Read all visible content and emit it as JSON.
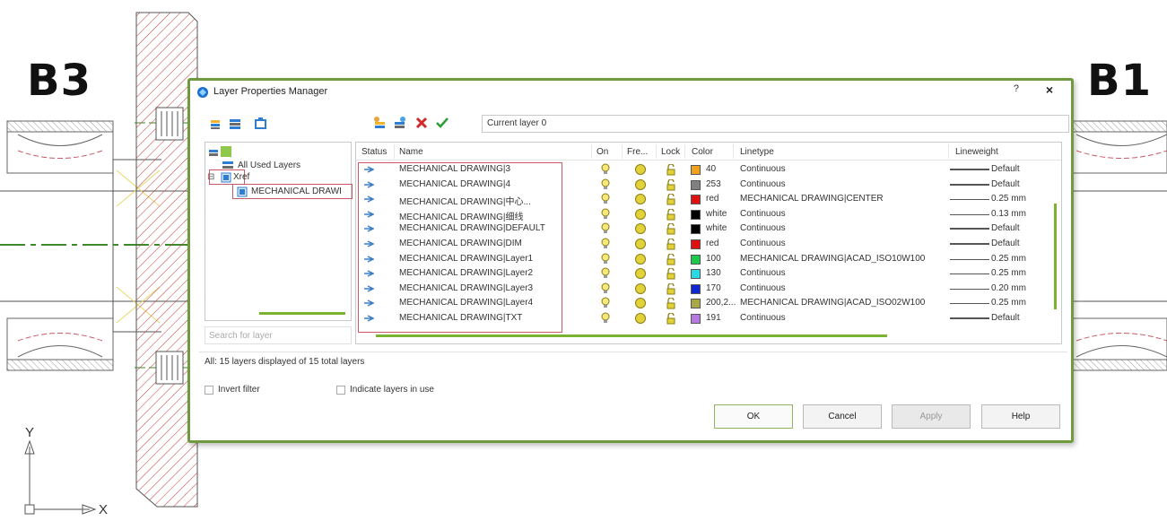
{
  "labels": {
    "left_view": "B3",
    "right_view": "B1",
    "axis_y": "Y",
    "axis_x": "X"
  },
  "dialog": {
    "title": "Layer Properties Manager",
    "help_glyph": "?",
    "close_glyph": "×",
    "current_layer": "Current layer 0",
    "tree": {
      "all_used": "All Used Layers",
      "xref": "Xref",
      "mech": "MECHANICAL DRAWI"
    },
    "search_placeholder": "Search for layer",
    "columns": [
      "Status",
      "Name",
      "On",
      "Fre...",
      "Lock",
      "Color",
      "Linetype",
      "Lineweight"
    ],
    "layers": [
      {
        "name": "MECHANICAL DRAWING|3",
        "color_hex": "#f0a21e",
        "color": "40",
        "linetype": "Continuous",
        "lineweight": "Default"
      },
      {
        "name": "MECHANICAL DRAWING|4",
        "color_hex": "#808080",
        "color": "253",
        "linetype": "Continuous",
        "lineweight": "Default"
      },
      {
        "name": "MECHANICAL DRAWING|中心...",
        "color_hex": "#e01010",
        "color": "red",
        "linetype": "MECHANICAL DRAWING|CENTER",
        "lineweight": "0.25 mm"
      },
      {
        "name": "MECHANICAL DRAWING|细线",
        "color_hex": "#000000",
        "color": "white",
        "linetype": "Continuous",
        "lineweight": "0.13 mm"
      },
      {
        "name": "MECHANICAL DRAWING|DEFAULT",
        "color_hex": "#000000",
        "color": "white",
        "linetype": "Continuous",
        "lineweight": "Default"
      },
      {
        "name": "MECHANICAL DRAWING|DIM",
        "color_hex": "#e01010",
        "color": "red",
        "linetype": "Continuous",
        "lineweight": "Default"
      },
      {
        "name": "MECHANICAL DRAWING|Layer1",
        "color_hex": "#1ec84a",
        "color": "100",
        "linetype": "MECHANICAL DRAWING|ACAD_ISO10W100",
        "lineweight": "0.25 mm"
      },
      {
        "name": "MECHANICAL DRAWING|Layer2",
        "color_hex": "#2ad9e3",
        "color": "130",
        "linetype": "Continuous",
        "lineweight": "0.25 mm"
      },
      {
        "name": "MECHANICAL DRAWING|Layer3",
        "color_hex": "#1226d0",
        "color": "170",
        "linetype": "Continuous",
        "lineweight": "0.20 mm"
      },
      {
        "name": "MECHANICAL DRAWING|Layer4",
        "color_hex": "#a8a848",
        "color": "200,2...",
        "linetype": "MECHANICAL DRAWING|ACAD_ISO02W100",
        "lineweight": "0.25 mm"
      },
      {
        "name": "MECHANICAL DRAWING|TXT",
        "color_hex": "#b679e0",
        "color": "191",
        "linetype": "Continuous",
        "lineweight": "Default"
      }
    ],
    "summary": "All: 15 layers displayed of 15 total layers",
    "invert_filter": "Invert filter",
    "indicate_layers": "Indicate layers in use",
    "buttons": {
      "ok": "OK",
      "cancel": "Cancel",
      "apply": "Apply",
      "help": "Help"
    },
    "accent_color": "#6f9a3f"
  }
}
